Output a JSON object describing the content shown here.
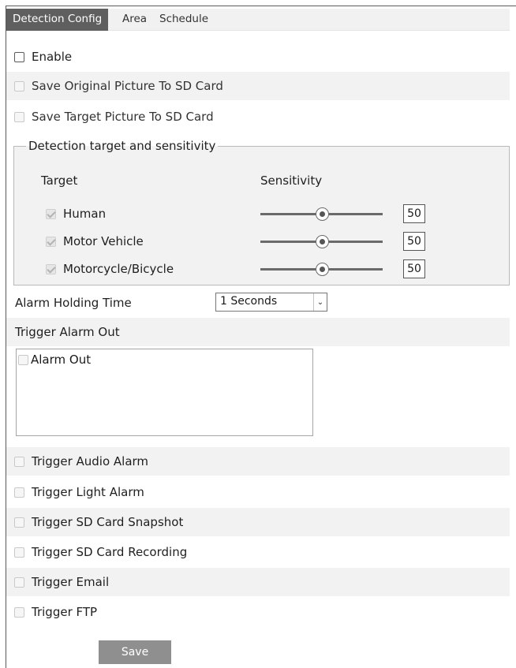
{
  "tabs": [
    {
      "label": "Detection Config",
      "active": true
    },
    {
      "label": "Area",
      "active": false
    },
    {
      "label": "Schedule",
      "active": false
    }
  ],
  "enable": {
    "label": "Enable",
    "checked": false
  },
  "save_original": {
    "label": "Save Original Picture To SD Card",
    "checked": false,
    "disabled": true
  },
  "save_target": {
    "label": "Save Target Picture To SD Card",
    "checked": false,
    "disabled": true
  },
  "detection_group": {
    "legend": "Detection target and sensitivity",
    "target_header": "Target",
    "sensitivity_header": "Sensitivity",
    "targets": [
      {
        "label": "Human",
        "checked": true,
        "sensitivity": "50",
        "level": 50
      },
      {
        "label": "Motor Vehicle",
        "checked": true,
        "sensitivity": "50",
        "level": 50
      },
      {
        "label": "Motorcycle/Bicycle",
        "checked": true,
        "sensitivity": "50",
        "level": 50
      }
    ]
  },
  "alarm_holding": {
    "label": "Alarm Holding Time",
    "value": "1 Seconds"
  },
  "trigger_alarm_out": {
    "label": "Trigger Alarm Out",
    "items": [
      {
        "label": "Alarm Out",
        "checked": false
      }
    ]
  },
  "triggers": [
    {
      "label": "Trigger Audio Alarm",
      "checked": false
    },
    {
      "label": "Trigger Light Alarm",
      "checked": false
    },
    {
      "label": "Trigger SD Card Snapshot",
      "checked": false
    },
    {
      "label": "Trigger SD Card Recording",
      "checked": false
    },
    {
      "label": "Trigger Email",
      "checked": false
    },
    {
      "label": "Trigger FTP",
      "checked": false
    }
  ],
  "save_button": "Save",
  "colors": {
    "active_tab": "#5f5f5f",
    "row_shade": "#f2f2f2",
    "save_button": "#8f8f8f"
  }
}
